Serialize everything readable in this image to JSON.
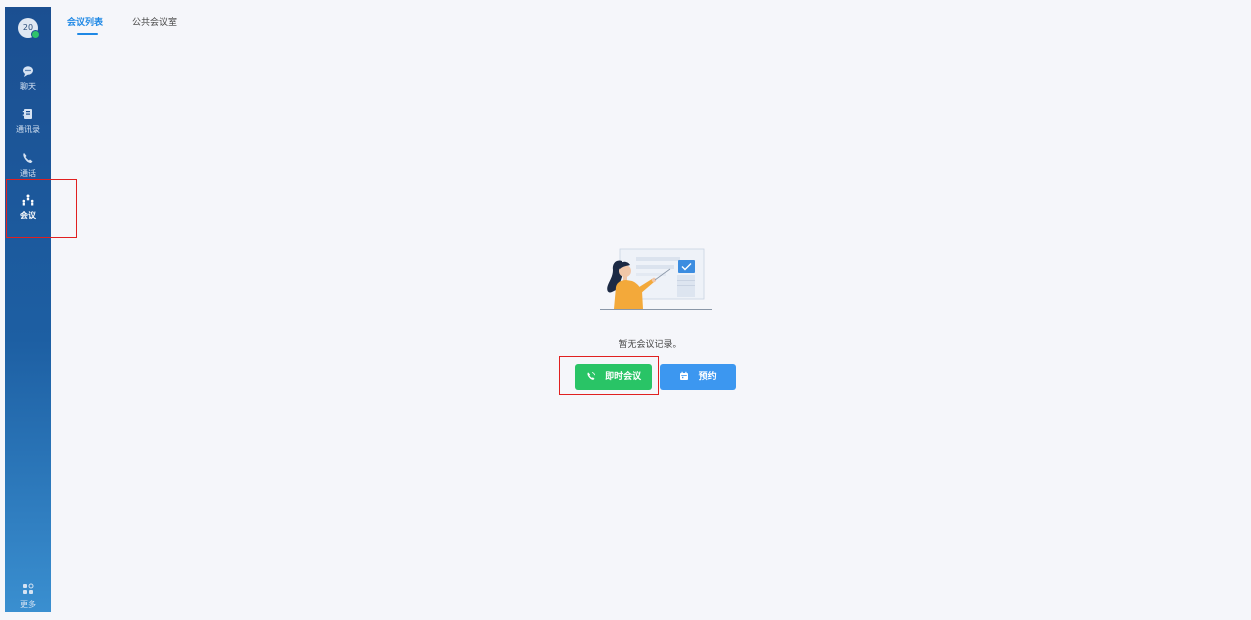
{
  "sidebar": {
    "avatar_text": "20",
    "items": [
      {
        "label": "聊天",
        "icon": "chat-icon"
      },
      {
        "label": "通讯录",
        "icon": "contacts-icon"
      },
      {
        "label": "通话",
        "icon": "phone-icon"
      },
      {
        "label": "会议",
        "icon": "meeting-icon",
        "active": true
      },
      {
        "label": "更多",
        "icon": "more-apps-icon"
      }
    ]
  },
  "tabs": [
    {
      "label": "会议列表",
      "active": true
    },
    {
      "label": "公共会议室",
      "active": false
    }
  ],
  "empty_state": {
    "message": "暂无会议记录。"
  },
  "actions": {
    "instant_meeting": "即时会议",
    "schedule": "预约"
  },
  "colors": {
    "accent": "#1e88e5",
    "green_button": "#29c466",
    "blue_button": "#3c97f0",
    "highlight": "#e02020"
  }
}
